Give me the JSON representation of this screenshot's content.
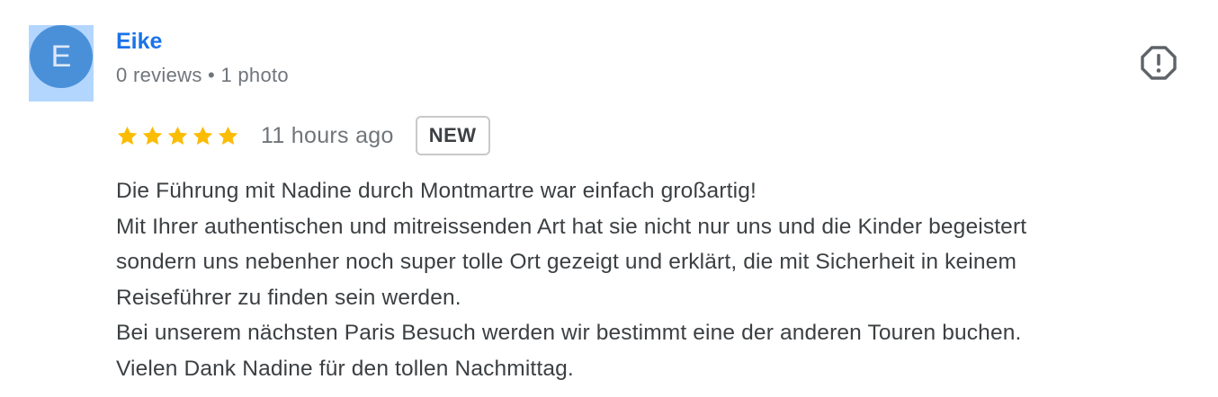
{
  "author": {
    "initial": "E",
    "name": "Eike",
    "meta": "0 reviews • 1 photo",
    "avatar_color": "#4a90d9"
  },
  "rating": {
    "stars": 5,
    "max_stars": 5,
    "star_color": "#fbbc04",
    "time": "11 hours ago",
    "badge": "NEW"
  },
  "report": {
    "icon": "report-icon"
  },
  "review": {
    "lines": [
      "Die Führung mit Nadine durch Montmartre war einfach großartig!",
      "Mit Ihrer authentischen und mitreissenden Art hat sie nicht nur uns und die Kinder begeistert",
      "sondern uns nebenher noch super tolle Ort gezeigt und erklärt, die mit Sicherheit in keinem",
      "Reiseführer zu finden sein werden.",
      "Bei unserem nächsten Paris Besuch werden wir bestimmt eine der anderen Touren buchen.",
      "Vielen Dank Nadine für den tollen Nachmittag."
    ]
  }
}
